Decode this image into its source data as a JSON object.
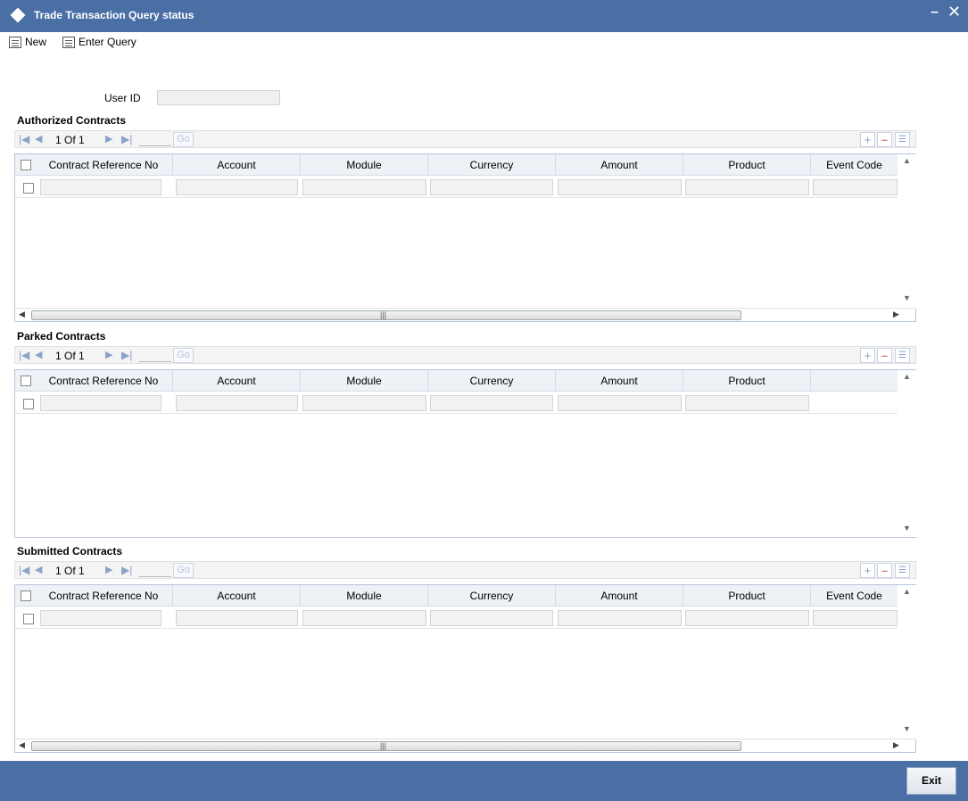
{
  "window": {
    "title": "Trade Transaction Query status",
    "minimize_glyph": "–",
    "close_glyph": "✕"
  },
  "toolbar": {
    "new_label": "New",
    "enter_query_label": "Enter Query"
  },
  "form": {
    "user_id_label": "User ID",
    "user_id_value": ""
  },
  "sections": {
    "authorized": {
      "title": "Authorized Contracts",
      "pager": {
        "text": "1 Of 1",
        "go_label": "Go"
      },
      "columns": [
        "Contract Reference No",
        "Account",
        "Module",
        "Currency",
        "Amount",
        "Product",
        "Event Code"
      ]
    },
    "parked": {
      "title": "Parked Contracts",
      "pager": {
        "text": "1 Of 1",
        "go_label": "Go"
      },
      "columns": [
        "Contract Reference No",
        "Account",
        "Module",
        "Currency",
        "Amount",
        "Product"
      ]
    },
    "submitted": {
      "title": "Submitted Contracts",
      "pager": {
        "text": "1 Of 1",
        "go_label": "Go"
      },
      "columns": [
        "Contract Reference No",
        "Account",
        "Module",
        "Currency",
        "Amount",
        "Product",
        "Event Code"
      ]
    }
  },
  "footer": {
    "exit_label": "Exit"
  },
  "colors": {
    "header_bar": "#4a6fa5",
    "grid_border": "#b7c6dc"
  },
  "icons": [
    "diamond-icon",
    "minimize-icon",
    "close-icon",
    "new-icon",
    "enter-query-icon",
    "first-page-icon",
    "prev-page-icon",
    "next-page-icon",
    "last-page-icon",
    "add-row-icon",
    "delete-row-icon",
    "view-row-icon"
  ]
}
